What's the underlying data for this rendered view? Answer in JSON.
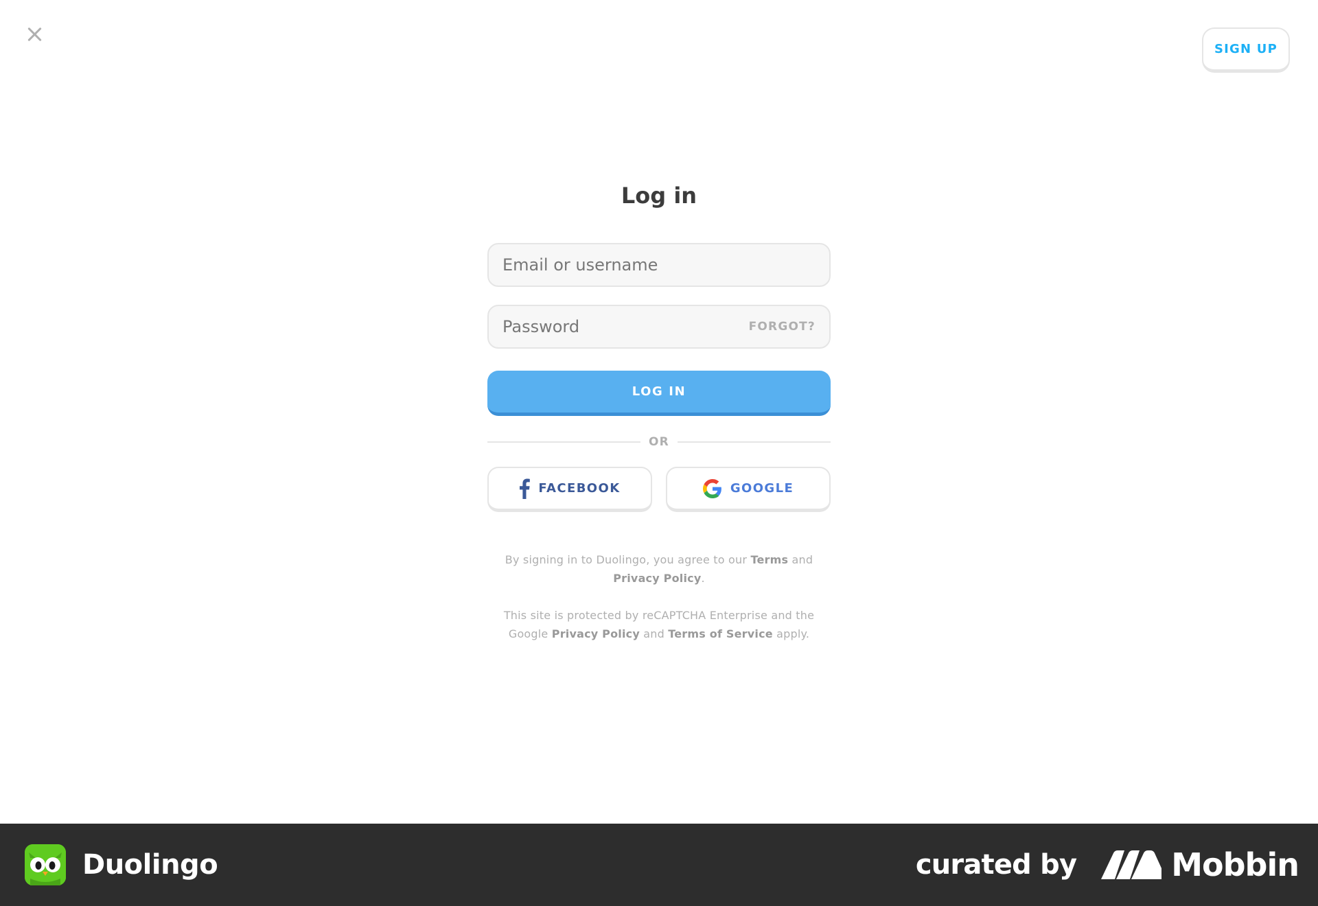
{
  "header": {
    "close_label": "close",
    "signup_label": "SIGN UP"
  },
  "login_form": {
    "title": "Log in",
    "email_placeholder": "Email or username",
    "password_placeholder": "Password",
    "forgot_label": "FORGOT?",
    "login_button": "LOG IN",
    "divider_text": "OR",
    "facebook_label": "FACEBOOK",
    "google_label": "GOOGLE"
  },
  "legal": {
    "agreement_prefix": "By signing in to Duolingo, you agree to our ",
    "terms_link": "Terms",
    "and_1": " and ",
    "privacy_link": "Privacy Policy",
    "agreement_suffix": ".",
    "recaptcha_prefix": "This site is protected by reCAPTCHA Enterprise and the Google ",
    "google_privacy_link": "Privacy Policy",
    "and_2": " and ",
    "terms_of_service_link": "Terms of Service",
    "recaptcha_suffix": " apply."
  },
  "footer": {
    "app_name": "Duolingo",
    "curated_by": "curated by",
    "curator_name": "Mobbin"
  },
  "colors": {
    "accent_blue": "#58b0f0",
    "signup_text": "#1cb0f6",
    "facebook": "#3b5998",
    "footer_bg": "#2d2d2d",
    "duolingo_green": "#5fcb20"
  },
  "icons": {
    "close": "close-icon",
    "facebook": "facebook-icon",
    "google": "google-icon",
    "duolingo": "duolingo-owl-icon",
    "mobbin": "mobbin-logo-icon"
  }
}
